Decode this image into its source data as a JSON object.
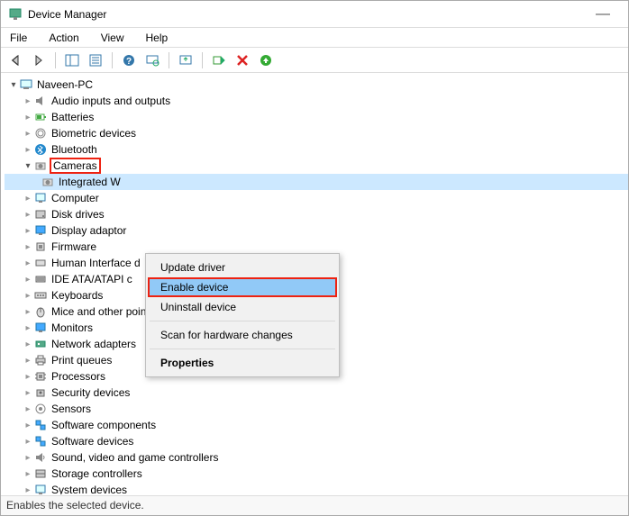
{
  "window": {
    "title": "Device Manager",
    "minimize_glyph": "—"
  },
  "menu": [
    "File",
    "Action",
    "View",
    "Help"
  ],
  "tree": {
    "root": "Naveen-PC",
    "categories": [
      "Audio inputs and outputs",
      "Batteries",
      "Biometric devices",
      "Bluetooth",
      "Cameras",
      "Computer",
      "Disk drives",
      "Display adaptor",
      "Firmware",
      "Human Interface d",
      "IDE ATA/ATAPI c",
      "Keyboards",
      "Mice and other pointing devices",
      "Monitors",
      "Network adapters",
      "Print queues",
      "Processors",
      "Security devices",
      "Sensors",
      "Software components",
      "Software devices",
      "Sound, video and game controllers",
      "Storage controllers",
      "System devices"
    ],
    "camera_child": "Integrated W"
  },
  "context_menu": {
    "items": [
      "Update driver",
      "Enable device",
      "Uninstall device",
      "Scan for hardware changes",
      "Properties"
    ]
  },
  "statusbar": "Enables the selected device."
}
